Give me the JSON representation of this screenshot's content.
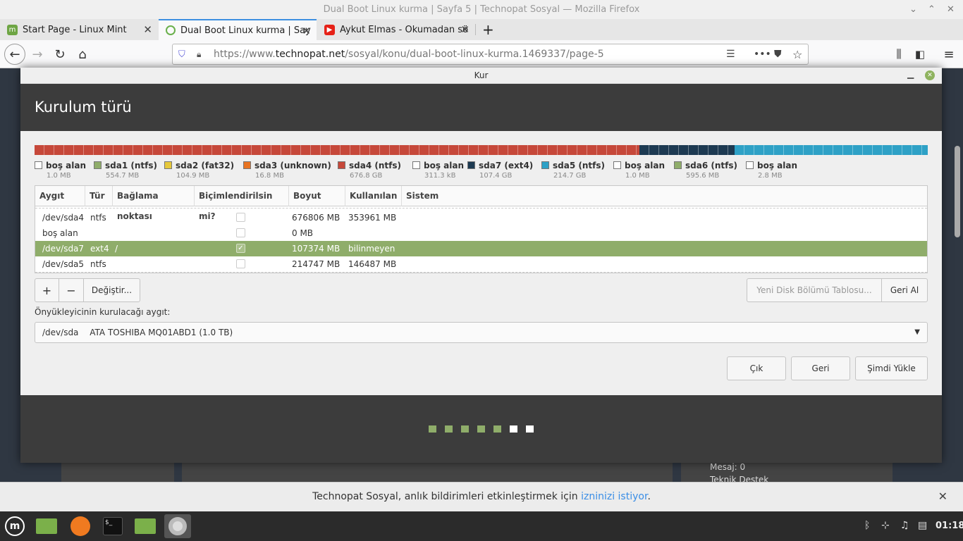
{
  "window": {
    "title": "Dual Boot Linux kurma | Sayfa 5 | Technopat Sosyal — Mozilla Firefox"
  },
  "tabs": [
    {
      "label": "Start Page - Linux Mint",
      "icon": "linux-mint-icon"
    },
    {
      "label": "Dual Boot Linux kurma | Say",
      "icon": "power-icon"
    },
    {
      "label": "Aykut Elmas - Okumadan sö",
      "icon": "youtube-icon"
    }
  ],
  "url": {
    "prefix": "https://www.",
    "domain": "technopat.net",
    "path": "/sosyal/konu/dual-boot-linux-kurma.1469337/page-5"
  },
  "dialog": {
    "title": "Kur",
    "heading": "Kurulum türü",
    "legend": [
      {
        "name": "boş alan",
        "size": "1.0 MB",
        "color": "#ffffff"
      },
      {
        "name": "sda1 (ntfs)",
        "size": "554.7 MB",
        "color": "#8fad6a"
      },
      {
        "name": "sda2 (fat32)",
        "size": "104.9 MB",
        "color": "#e6c83a"
      },
      {
        "name": "sda3 (unknown)",
        "size": "16.8 MB",
        "color": "#e87422"
      },
      {
        "name": "sda4 (ntfs)",
        "size": "676.8 GB",
        "color": "#c6483a"
      },
      {
        "name": "boş alan",
        "size": "311.3 kB",
        "color": "#ffffff"
      },
      {
        "name": "sda7 (ext4)",
        "size": "107.4 GB",
        "color": "#1d3a52"
      },
      {
        "name": "sda5 (ntfs)",
        "size": "214.7 GB",
        "color": "#2ea1c6"
      },
      {
        "name": "boş alan",
        "size": "1.0 MB",
        "color": "#ffffff"
      },
      {
        "name": "sda6 (ntfs)",
        "size": "595.6 MB",
        "color": "#8fad6a"
      },
      {
        "name": "boş alan",
        "size": "2.8 MB",
        "color": "#ffffff"
      }
    ],
    "bar": [
      {
        "label": "sda4",
        "color": "#c6483a",
        "fraction": 0.677
      },
      {
        "label": "sda7",
        "color": "#1d3a52",
        "fraction": 0.107
      },
      {
        "label": "sda5",
        "color": "#2ea1c6",
        "fraction": 0.216
      }
    ],
    "columns": [
      "Aygıt",
      "Tür",
      "Bağlama noktası",
      "Biçimlendirilsin mi?",
      "Boyut",
      "Kullanılan",
      "Sistem"
    ],
    "rows": [
      {
        "device": "/dev/sda4",
        "type": "ntfs",
        "mount": "",
        "format": false,
        "size": "676806 MB",
        "used": "353961 MB",
        "system": ""
      },
      {
        "device": "boş alan",
        "type": "",
        "mount": "",
        "format": false,
        "size": "0 MB",
        "used": "",
        "system": ""
      },
      {
        "device": "/dev/sda7",
        "type": "ext4",
        "mount": "/",
        "format": true,
        "size": "107374 MB",
        "used": "bilinmeyen",
        "system": "",
        "selected": true
      },
      {
        "device": "/dev/sda5",
        "type": "ntfs",
        "mount": "",
        "format": false,
        "size": "214747 MB",
        "used": "146487 MB",
        "system": ""
      }
    ],
    "buttons": {
      "add": "+",
      "remove": "−",
      "change": "Değiştir...",
      "new_table": "Yeni Disk Bölümü Tablosu...",
      "revert": "Geri Al",
      "quit": "Çık",
      "back": "Geri",
      "install": "Şimdi Yükle"
    },
    "boot_label": "Önyükleyicinin kurulacağı aygıt:",
    "boot_device": "/dev/sda",
    "boot_model": "ATA TOSHIBA MQ01ABD1 (1.0 TB)",
    "progress_dots": [
      true,
      true,
      true,
      true,
      true,
      false,
      false
    ]
  },
  "page": {
    "msg": "Mesaj: 0",
    "support": "Teknik Destek"
  },
  "notification": {
    "text": "Technopat Sosyal, anlık bildirimleri etkinleştirmek için ",
    "link": "izninizi istiyor",
    "end": "."
  },
  "taskbar": {
    "clock": "01:18"
  }
}
